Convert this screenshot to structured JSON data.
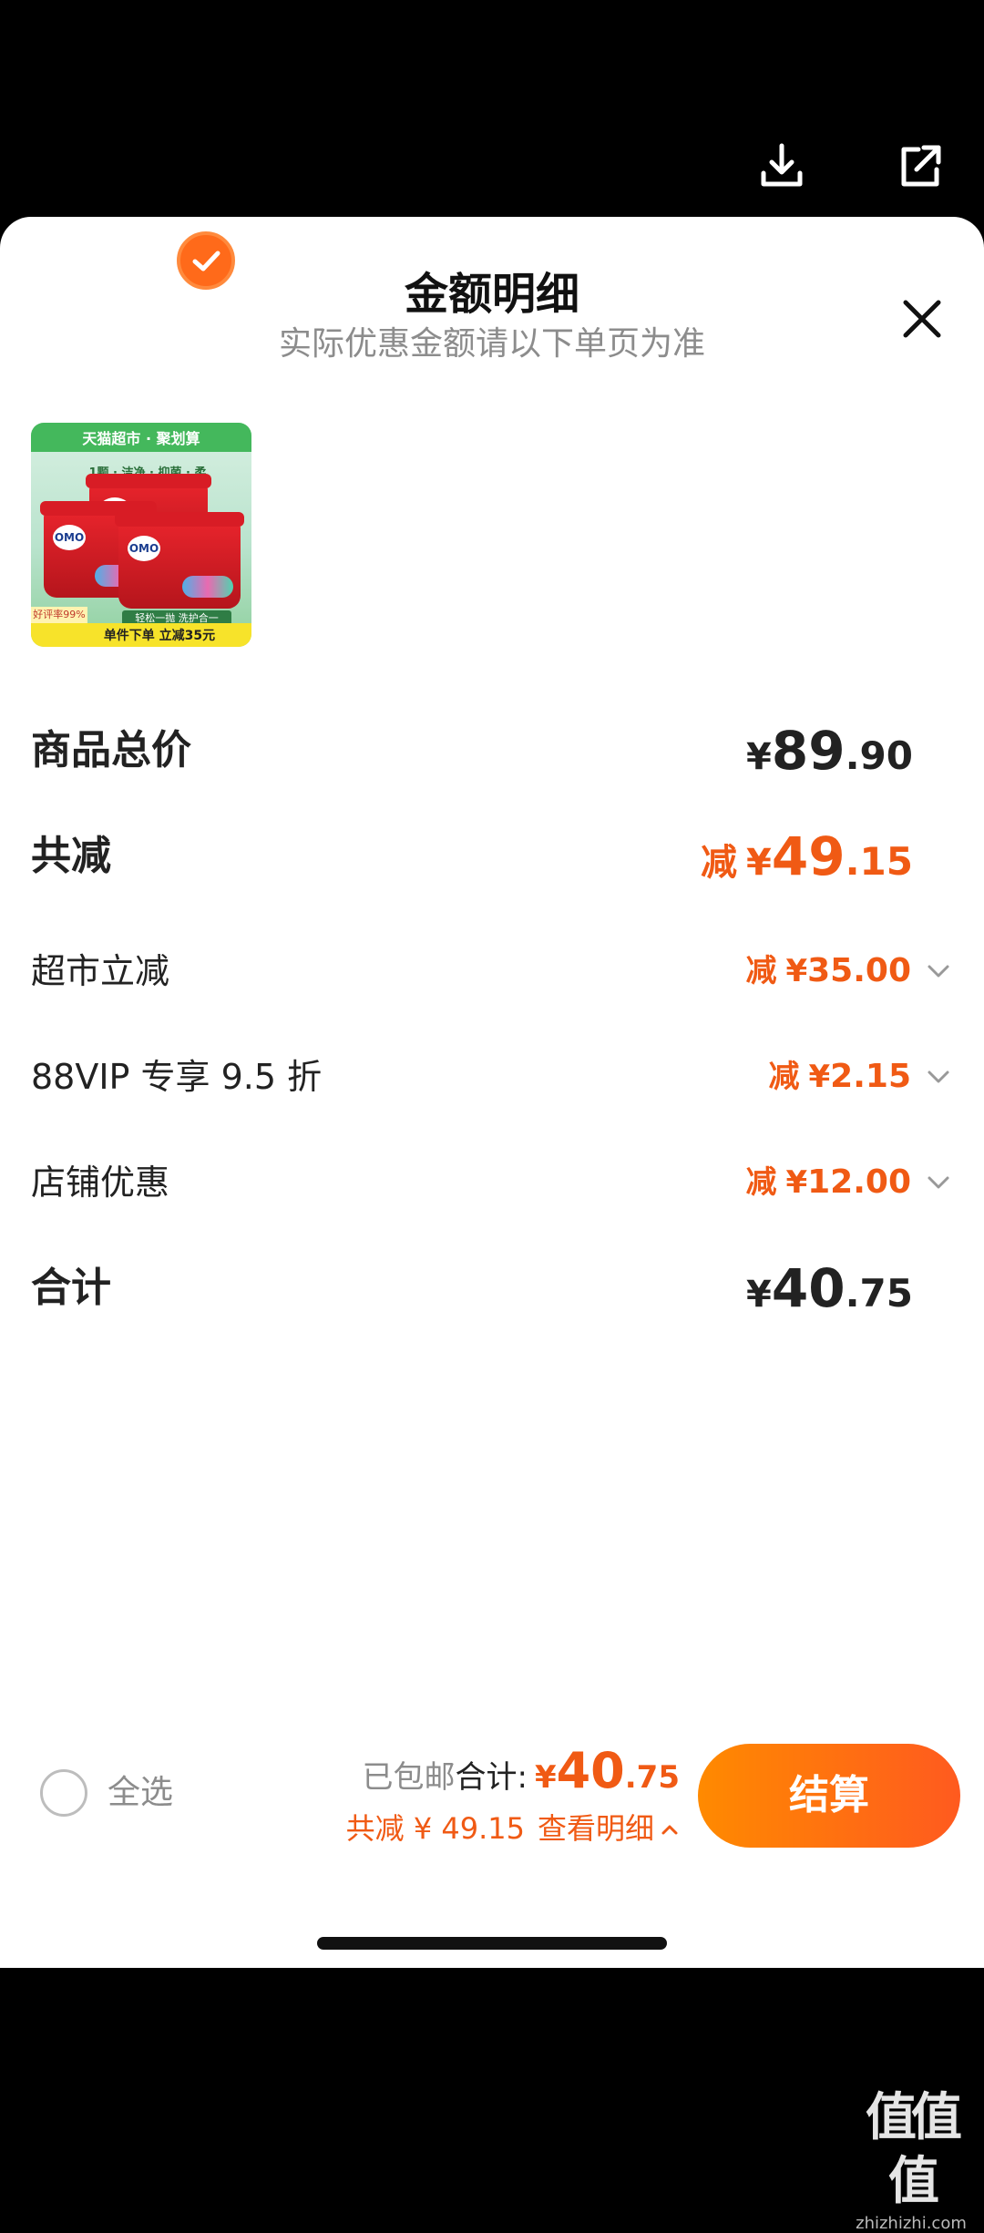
{
  "top_actions": {
    "download_icon": "download-icon",
    "share_icon": "share-icon"
  },
  "sheet": {
    "title": "金额明细",
    "subtitle": "实际优惠金额请以下单页为准"
  },
  "product": {
    "banner": "天猫超市 · 聚划算",
    "tagline": "1颗 · 洁净 · 抑菌 · 柔",
    "brand": "OMO",
    "sub_tag": "轻松一抛 洗护合一",
    "rating": "好评率99%",
    "promo": "单件下单 立减35元",
    "selected": true
  },
  "rows": [
    {
      "label": "商品总价",
      "prefix": "",
      "currency": "¥",
      "int": "89",
      "dec": ".90",
      "tone": "dark",
      "style": "big",
      "expandable": false
    },
    {
      "label": "共减",
      "prefix": "减",
      "currency": "¥",
      "int": "49",
      "dec": ".15",
      "tone": "orange",
      "style": "big",
      "expandable": false
    },
    {
      "label": "超市立减",
      "prefix": "减",
      "currency": "¥",
      "int": "35",
      "dec": ".00",
      "tone": "orange",
      "style": "sub",
      "expandable": true
    },
    {
      "label": "88VIP 专享 9.5 折",
      "prefix": "减",
      "currency": "¥",
      "int": "2",
      "dec": ".15",
      "tone": "orange",
      "style": "sub",
      "expandable": true
    },
    {
      "label": "店铺优惠",
      "prefix": "减",
      "currency": "¥",
      "int": "12",
      "dec": ".00",
      "tone": "orange",
      "style": "sub",
      "expandable": true
    },
    {
      "label": "合计",
      "prefix": "",
      "currency": "¥",
      "int": "40",
      "dec": ".75",
      "tone": "dark",
      "style": "big",
      "expandable": false
    }
  ],
  "bottom_bar": {
    "select_all_label": "全选",
    "shipping": "已包邮",
    "total_label": "合计:",
    "total_currency": "¥",
    "total_int": "40",
    "total_dec": ".75",
    "discount_text": "共减 ¥ 49.15",
    "view_details": "查看明细",
    "checkout_label": "结算"
  },
  "watermark": {
    "logo": "值值值",
    "url": "zhizhizhi.com"
  },
  "colors": {
    "accent": "#f05a14",
    "checkout_start": "#ff8a00",
    "checkout_end": "#ff5a1f"
  }
}
